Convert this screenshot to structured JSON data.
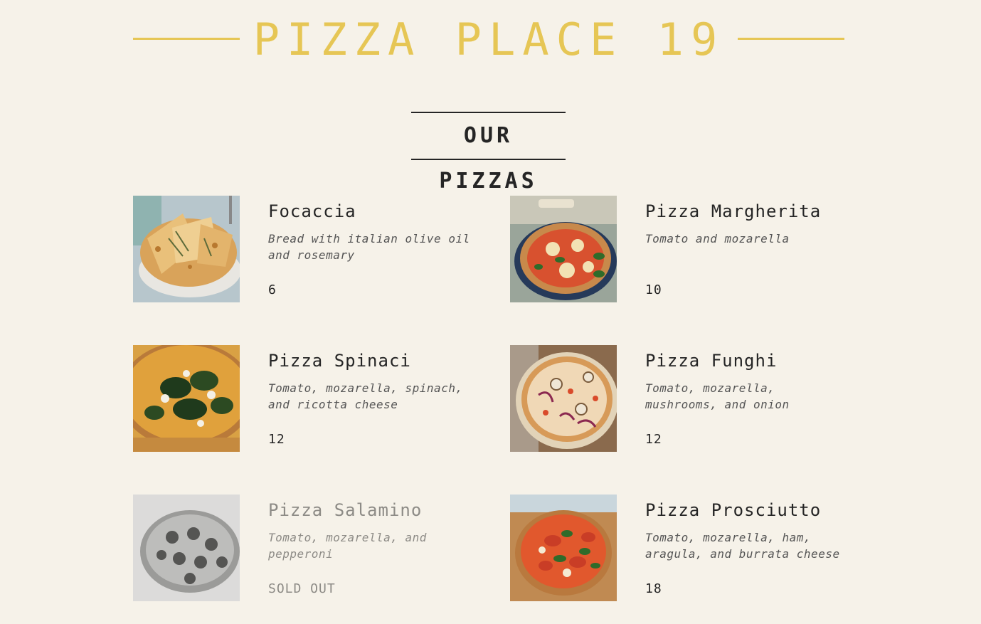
{
  "header": {
    "title": "PIZZA PLACE 19"
  },
  "section": {
    "title": "OUR PIZZAS"
  },
  "menu": [
    {
      "name": "Focaccia",
      "description": "Bread with italian olive oil and rosemary",
      "price": "6",
      "image": "focaccia-photo"
    },
    {
      "name": "Pizza Margherita",
      "description": "Tomato and mozarella",
      "price": "10",
      "image": "margherita-photo"
    },
    {
      "name": "Pizza Spinaci",
      "description": "Tomato, mozarella, spinach, and ricotta cheese",
      "price": "12",
      "image": "spinaci-photo"
    },
    {
      "name": "Pizza Funghi",
      "description": "Tomato, mozarella, mushrooms, and onion",
      "price": "12",
      "image": "funghi-photo"
    },
    {
      "name": "Pizza Salamino",
      "description": "Tomato, mozarella, and pepperoni",
      "price": "SOLD OUT",
      "image": "salamino-photo",
      "sold_out": true
    },
    {
      "name": "Pizza Prosciutto",
      "description": "Tomato, mozarella, ham, aragula, and burrata cheese",
      "price": "18",
      "image": "prosciutto-photo"
    }
  ],
  "colors": {
    "accent": "#e6c655",
    "background": "#f6f2e9",
    "text": "#252525",
    "muted": "#8d8b86"
  }
}
